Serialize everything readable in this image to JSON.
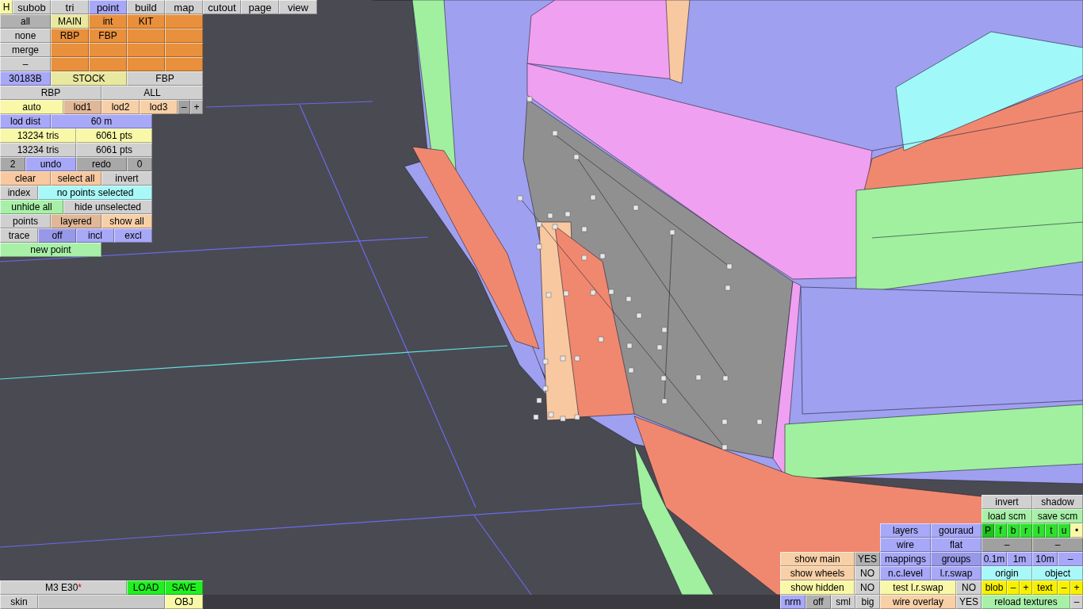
{
  "help_button": {
    "label": "H"
  },
  "top_tabs": [
    {
      "label": "subob",
      "selected": false
    },
    {
      "label": "tri",
      "selected": false
    },
    {
      "label": "point",
      "selected": true
    },
    {
      "label": "build",
      "selected": false
    },
    {
      "label": "map",
      "selected": false
    },
    {
      "label": "cutout",
      "selected": false
    },
    {
      "label": "page",
      "selected": false
    },
    {
      "label": "view",
      "selected": false
    }
  ],
  "left_panel": {
    "rows": [
      {
        "buttons": [
          {
            "label": "all",
            "color": "#b0b0b0"
          },
          {
            "label": "MAIN",
            "color": "#e8e8a0"
          },
          {
            "label": "int",
            "color": "#e8903c"
          },
          {
            "label": "KIT",
            "color": "#e8903c"
          },
          {
            "color": "#e8903c"
          }
        ]
      },
      {
        "buttons": [
          {
            "label": "none",
            "color": "#d0d0d0"
          },
          {
            "label": "RBP",
            "color": "#e8903c"
          },
          {
            "label": "FBP",
            "color": "#e8903c"
          },
          {
            "color": "#e8903c"
          },
          {
            "color": "#e8903c"
          }
        ]
      },
      {
        "buttons": [
          {
            "label": "merge",
            "color": "#d0d0d0"
          },
          {
            "color": "#e8903c"
          },
          {
            "color": "#e8903c"
          },
          {
            "color": "#e8903c"
          },
          {
            "color": "#e8903c"
          }
        ]
      },
      {
        "buttons": [
          {
            "label": "–",
            "color": "#d0d0d0"
          },
          {
            "color": "#e8903c"
          },
          {
            "color": "#e8903c"
          },
          {
            "color": "#e8903c"
          },
          {
            "color": "#e8903c"
          }
        ]
      },
      {
        "buttons": [
          {
            "label": "30183B",
            "color": "#a8a8f8"
          },
          {
            "label": "STOCK",
            "color": "#e8e8a0"
          },
          {
            "label": "FBP",
            "color": "#d0d0d0"
          }
        ]
      },
      {
        "buttons": [
          {
            "label": "RBP",
            "color": "#d0d0d0"
          },
          {
            "label": "ALL",
            "color": "#d0d0d0"
          }
        ]
      },
      {
        "buttons": [
          {
            "label": "auto",
            "color": "#f8f8a8"
          },
          {
            "label": "lod1",
            "color": "#e0b898"
          },
          {
            "label": "lod2",
            "color": "#f8d0a8"
          },
          {
            "label": "lod3",
            "color": "#f8d0a8"
          },
          {
            "label": "–",
            "color": "#a0a0a0"
          },
          {
            "label": "+",
            "color": "#b8b8b8"
          }
        ]
      },
      {
        "buttons": [
          {
            "label": "lod dist",
            "color": "#a8a8f8"
          },
          {
            "label": "60 m",
            "color": "#a8a8f8"
          }
        ]
      },
      {
        "buttons": [
          {
            "label": "13234 tris",
            "color": "#f8f8a8"
          },
          {
            "label": "6061 pts",
            "color": "#f8f8a8"
          }
        ]
      },
      {
        "buttons": [
          {
            "label": "13234 tris",
            "color": "#d0d0d0"
          },
          {
            "label": "6061 pts",
            "color": "#d0d0d0"
          }
        ]
      },
      {
        "buttons": [
          {
            "label": "2",
            "color": "#a8a8a8"
          },
          {
            "label": "undo",
            "color": "#a8a8f8"
          },
          {
            "label": "redo",
            "color": "#a8a8a8"
          },
          {
            "label": "0",
            "color": "#a8a8a8"
          }
        ]
      },
      {
        "buttons": [
          {
            "label": "clear",
            "color": "#f8c8a0"
          },
          {
            "label": "select all",
            "color": "#f8c8a0"
          },
          {
            "label": "invert",
            "color": "#d0d0d0"
          }
        ]
      },
      {
        "buttons": [
          {
            "label": "index",
            "color": "#d0d0d0"
          },
          {
            "label": "no points selected",
            "color": "#a8f8f8"
          }
        ]
      },
      {
        "buttons": [
          {
            "label": "unhide all",
            "color": "#a8f0a8"
          },
          {
            "label": "hide unselected",
            "color": "#d0d0d0"
          }
        ]
      },
      {
        "buttons": [
          {
            "label": "points",
            "color": "#d0d0d0"
          },
          {
            "label": "layered",
            "color": "#e0b898"
          },
          {
            "label": "show all",
            "color": "#f8d0a8"
          }
        ]
      },
      {
        "buttons": [
          {
            "label": "trace",
            "color": "#d0d0d0"
          },
          {
            "label": "off",
            "color": "#9898e8"
          },
          {
            "label": "incl",
            "color": "#a8a8f8"
          },
          {
            "label": "excl",
            "color": "#a8a8f8"
          }
        ]
      },
      {
        "buttons": [
          {
            "label": "new point",
            "color": "#a8f0a8"
          }
        ]
      }
    ]
  },
  "file_bar": {
    "model_name": "M3 E30",
    "modified_mark": "*",
    "load": "LOAD",
    "save": "SAVE",
    "skin": "skin",
    "export": "OBJ"
  },
  "display_panel": {
    "rows": [
      {
        "buttons": [
          {
            "label": "show main",
            "color": "#f8d0a8"
          },
          {
            "label": "YES",
            "color": "#b0b0b0"
          }
        ]
      },
      {
        "buttons": [
          {
            "label": "show wheels",
            "color": "#f8d0a8"
          },
          {
            "label": "NO",
            "color": "#d0d0d0"
          }
        ]
      },
      {
        "buttons": [
          {
            "label": "show hidden",
            "color": "#f8f8a8"
          },
          {
            "label": "NO",
            "color": "#d0d0d0"
          }
        ]
      },
      {
        "buttons": [
          {
            "label": "nrm",
            "color": "#a8a8f8"
          },
          {
            "label": "off",
            "color": "#b0b0b0"
          },
          {
            "label": "sml",
            "color": "#d0d0d0"
          },
          {
            "label": "big",
            "color": "#d0d0d0"
          }
        ]
      }
    ]
  },
  "render_panel": {
    "rows": [
      {
        "buttons": [
          {
            "label": "layers",
            "color": "#a8a8f8"
          },
          {
            "label": "gouraud",
            "color": "#a8a8f8"
          }
        ]
      },
      {
        "buttons": [
          {
            "label": "wire",
            "color": "#a8a8f8"
          },
          {
            "label": "flat",
            "color": "#a8a8f8"
          }
        ]
      },
      {
        "buttons": [
          {
            "label": "mappings",
            "color": "#a8a8f8"
          },
          {
            "label": "groups",
            "color": "#9898e8"
          }
        ]
      },
      {
        "buttons": [
          {
            "label": "n.c.level",
            "color": "#a8a8f8"
          },
          {
            "label": "l.r.swap",
            "color": "#a8a8f8"
          }
        ]
      },
      {
        "buttons": [
          {
            "label": "test l.r.swap",
            "color": "#f8f8a8"
          },
          {
            "label": "NO",
            "color": "#d0d0d0"
          }
        ]
      },
      {
        "buttons": [
          {
            "label": "wire overlay",
            "color": "#f8d0a8"
          },
          {
            "label": "YES",
            "color": "#d0d0d0"
          }
        ]
      }
    ]
  },
  "tools_panel": {
    "rows": [
      {
        "buttons": [
          {
            "label": "invert",
            "color": "#d0d0d0"
          },
          {
            "label": "shadow",
            "color": "#d0d0d0"
          }
        ]
      },
      {
        "buttons": [
          {
            "label": "load scm",
            "color": "#a8f0a8"
          },
          {
            "label": "save scm",
            "color": "#a8f0a8"
          }
        ]
      },
      {
        "buttons": [
          {
            "label": "P",
            "color": "#20c020"
          },
          {
            "label": "f",
            "color": "#30e030"
          },
          {
            "label": "b",
            "color": "#30e030"
          },
          {
            "label": "r",
            "color": "#30e030"
          },
          {
            "label": "l",
            "color": "#30e030"
          },
          {
            "label": "t",
            "color": "#30e030"
          },
          {
            "label": "u",
            "color": "#30e030"
          },
          {
            "label": "•",
            "color": "#f8f8a8"
          }
        ]
      },
      {
        "buttons": [
          {
            "label": "–",
            "color": "#a0a0a0"
          },
          {
            "label": "–",
            "color": "#a0a0a0"
          }
        ]
      },
      {
        "buttons": [
          {
            "label": "0.1m",
            "color": "#a8a8f8"
          },
          {
            "label": "1m",
            "color": "#a8a8f8"
          },
          {
            "label": "10m",
            "color": "#a8a8f8"
          },
          {
            "label": "–",
            "color": "#a8a8f8"
          }
        ]
      },
      {
        "buttons": [
          {
            "label": "origin",
            "color": "#a8f8f8"
          },
          {
            "label": "object",
            "color": "#a8f8f8"
          }
        ]
      },
      {
        "buttons": [
          {
            "label": "blob",
            "color": "#f8f000"
          },
          {
            "label": "–",
            "color": "#f8f000"
          },
          {
            "label": "+",
            "color": "#f8f000"
          },
          {
            "label": "text",
            "color": "#f8f000"
          },
          {
            "label": "–",
            "color": "#f8f000"
          },
          {
            "label": "+",
            "color": "#f8f000"
          }
        ]
      },
      {
        "buttons": [
          {
            "label": "reload textures",
            "color": "#a8f0a8"
          },
          {
            "label": "–",
            "color": "#d0d0d0"
          }
        ]
      }
    ]
  }
}
